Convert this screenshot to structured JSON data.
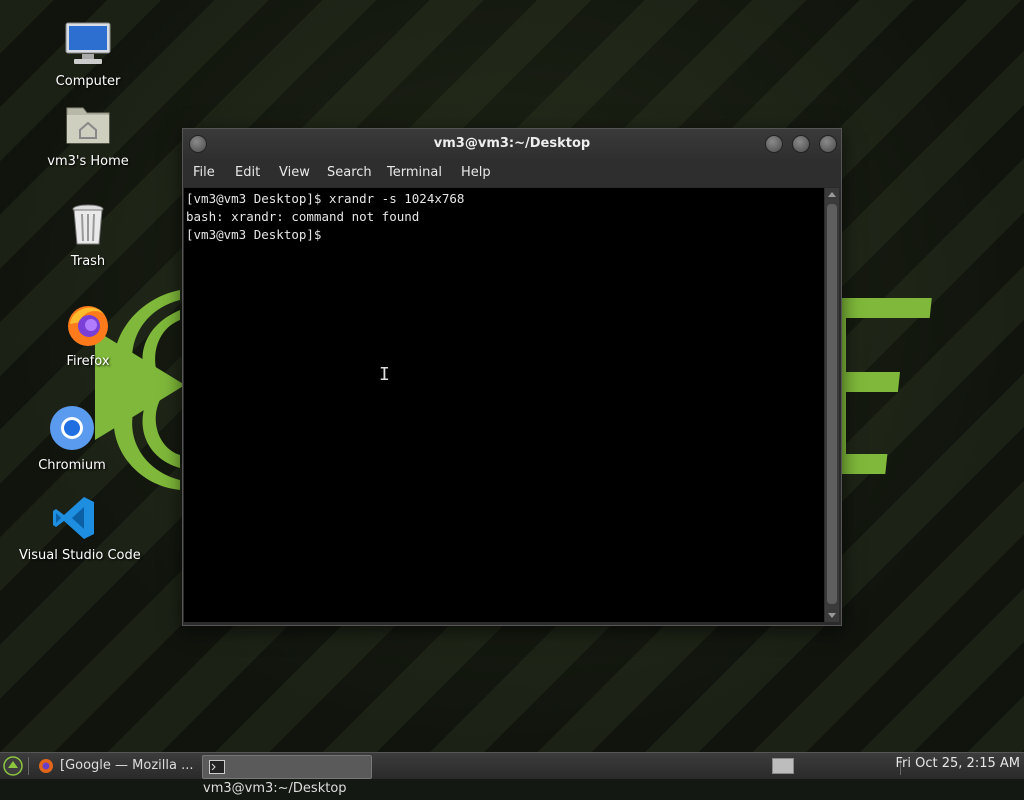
{
  "desktop": {
    "icons": [
      {
        "label": "Computer",
        "icon": "computer-icon"
      },
      {
        "label": "vm3's Home",
        "icon": "home-folder-icon"
      },
      {
        "label": "Trash",
        "icon": "trash-icon"
      },
      {
        "label": "Firefox",
        "icon": "firefox-icon"
      },
      {
        "label": "Chromium",
        "icon": "chromium-icon"
      },
      {
        "label": "Visual Studio Code",
        "icon": "vscode-icon"
      }
    ],
    "accent": "#8cc63f"
  },
  "terminal": {
    "title": "vm3@vm3:~/Desktop",
    "menu": [
      "File",
      "Edit",
      "View",
      "Search",
      "Terminal",
      "Help"
    ],
    "lines": [
      "[vm3@vm3 Desktop]$ xrandr -s 1024x768",
      "bash: xrandr: command not found",
      "[vm3@vm3 Desktop]$ "
    ]
  },
  "taskbar": {
    "tasks": [
      {
        "label": "[Google — Mozilla ...",
        "icon": "firefox-icon"
      },
      {
        "label": "vm3@vm3:~/Desktop",
        "icon": "terminal-icon"
      }
    ],
    "clock": "Fri Oct 25,  2:15 AM"
  }
}
